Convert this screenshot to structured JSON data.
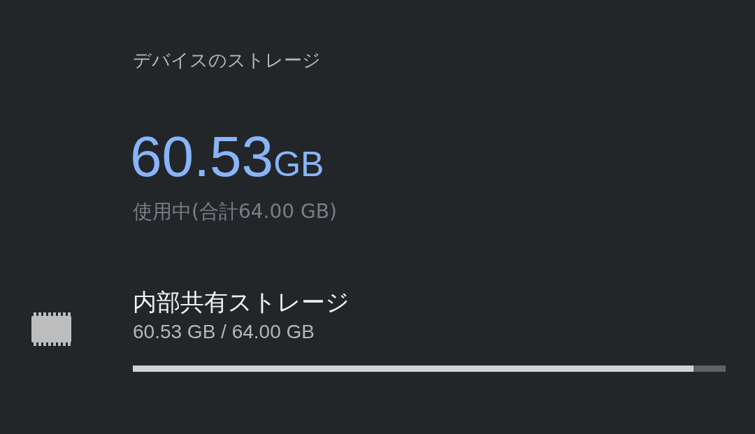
{
  "header": "デバイスのストレージ",
  "summary": {
    "used_value": "60.53",
    "used_unit": "GB",
    "caption": "使用中(合計64.00 GB)"
  },
  "volumes": [
    {
      "title": "内部共有ストレージ",
      "usage": "60.53 GB / 64.00 GB",
      "level": 0.946
    }
  ]
}
